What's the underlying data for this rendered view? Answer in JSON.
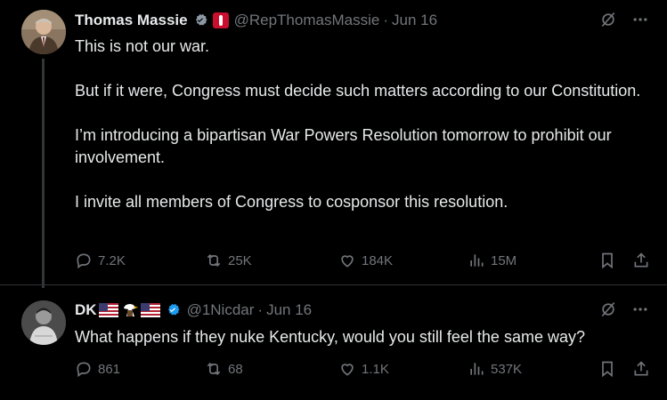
{
  "tweets": [
    {
      "author_name": "Thomas Massie",
      "handle": "@RepThomasMassie",
      "separator": "·",
      "date": "Jun 16",
      "paragraphs": [
        "This is not our war.",
        "But if it were, Congress must decide such matters according to our Constitution.",
        "I’m introducing a bipartisan War Powers Resolution tomorrow to prohibit our involvement.",
        "I invite all members of Congress to cosponsor this resolution."
      ],
      "reply_count": "7.2K",
      "retweet_count": "25K",
      "like_count": "184K",
      "view_count": "15M"
    },
    {
      "author_name": "DK",
      "handle": "@1Nicdar",
      "separator": "·",
      "date": "Jun 16",
      "paragraphs": [
        "What happens if they nuke Kentucky, would you still feel the same way?"
      ],
      "reply_count": "861",
      "retweet_count": "68",
      "like_count": "1.1K",
      "view_count": "537K"
    }
  ],
  "colors": {
    "background": "#000000",
    "text_primary": "#e7e9ea",
    "text_secondary": "#71767b",
    "verified_blue": "#1d9bf0",
    "divider": "#2f3336"
  },
  "icons": [
    "verified-icon",
    "grok-icon",
    "more-icon",
    "reply-icon",
    "retweet-icon",
    "like-icon",
    "views-icon",
    "bookmark-icon",
    "share-icon"
  ]
}
